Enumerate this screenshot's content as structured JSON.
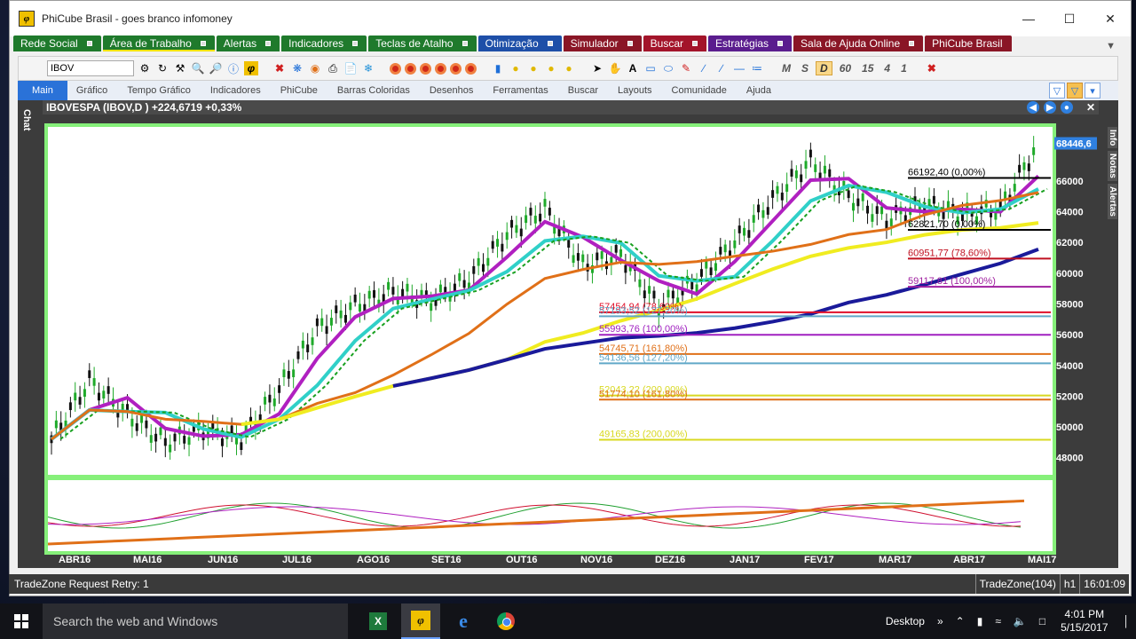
{
  "window": {
    "title": "PhiCube Brasil - goes branco infomoney",
    "logo": "phi-logo"
  },
  "top_tabs": [
    {
      "label": "Rede Social",
      "color": "#1f7a2c"
    },
    {
      "label": "Área de Trabalho",
      "color": "#1f7a2c",
      "active": true
    },
    {
      "label": "Alertas",
      "color": "#1f7a2c"
    },
    {
      "label": "Indicadores",
      "color": "#1f7a2c"
    },
    {
      "label": "Teclas de Atalho",
      "color": "#1f7a2c"
    },
    {
      "label": "Otimização",
      "color": "#1e4fa8"
    },
    {
      "label": "Simulador",
      "color": "#8a1626"
    },
    {
      "label": "Buscar",
      "color": "#a3142a"
    },
    {
      "label": "Estratégias",
      "color": "#5a1d8e"
    },
    {
      "label": "Sala de Ajuda Online",
      "color": "#8a1626"
    },
    {
      "label": "PhiCube Brasil",
      "color": "#8a1626"
    }
  ],
  "toolbar": {
    "symbol_value": "IBOV",
    "periods": [
      "M",
      "S",
      "D",
      "60",
      "15",
      "4",
      "1"
    ],
    "active_period": "D"
  },
  "menu": {
    "items": [
      "Main",
      "Gráfico",
      "Tempo Gráfico",
      "Indicadores",
      "PhiCube",
      "Barras Coloridas",
      "Desenhos",
      "Ferramentas",
      "Buscar",
      "Layouts",
      "Comunidade",
      "Ajuda"
    ],
    "active": "Main"
  },
  "chart": {
    "header": "IBOVESPA (IBOV,D ) +224,6719 +0,33%",
    "left_tab": "Chat",
    "right_tabs": [
      "Info",
      "Notas",
      "Alertas"
    ],
    "last_price": "68446,6",
    "accent": "#2f80e0",
    "background": "#ffffff",
    "border": "#86f07a"
  },
  "chart_data": {
    "type": "line",
    "title": "IBOVESPA (IBOV,D ) +224,6719 +0,33%",
    "x_tick_labels": [
      "ABR16",
      "MAI16",
      "JUN16",
      "JUL16",
      "AGO16",
      "SET16",
      "OUT16",
      "NOV16",
      "DEZ16",
      "JAN17",
      "FEV17",
      "MAR17",
      "ABR17",
      "MAI17"
    ],
    "y_tick_labels": [
      "48000",
      "50000",
      "52000",
      "54000",
      "56000",
      "58000",
      "60000",
      "62000",
      "64000",
      "66000"
    ],
    "ylim": [
      47000,
      69400
    ],
    "last_value": 68446.6,
    "price_series": [
      {
        "month": "ABR16",
        "value": 49200
      },
      {
        "month": "ABR16b",
        "value": 53000
      },
      {
        "month": "MAI16",
        "value": 50800
      },
      {
        "month": "MAI16b",
        "value": 49000
      },
      {
        "month": "JUN16",
        "value": 49800
      },
      {
        "month": "JUN16b",
        "value": 49200
      },
      {
        "month": "JUL16",
        "value": 52500
      },
      {
        "month": "JUL16b",
        "value": 56400
      },
      {
        "month": "AGO16",
        "value": 57900
      },
      {
        "month": "AGO16b",
        "value": 58800
      },
      {
        "month": "SET16",
        "value": 58200
      },
      {
        "month": "SET16b",
        "value": 59600
      },
      {
        "month": "OUT16",
        "value": 62500
      },
      {
        "month": "OUT16b",
        "value": 64200
      },
      {
        "month": "NOV16",
        "value": 60500
      },
      {
        "month": "NOV16b",
        "value": 61200
      },
      {
        "month": "DEZ16",
        "value": 57800
      },
      {
        "month": "DEZ16b",
        "value": 59500
      },
      {
        "month": "JAN17",
        "value": 62000
      },
      {
        "month": "JAN17b",
        "value": 64800
      },
      {
        "month": "FEV17",
        "value": 67300
      },
      {
        "month": "FEV17b",
        "value": 65000
      },
      {
        "month": "MAR17",
        "value": 63500
      },
      {
        "month": "MAR17b",
        "value": 64500
      },
      {
        "month": "ABR17",
        "value": 63800
      },
      {
        "month": "ABR17b",
        "value": 64200
      },
      {
        "month": "MAI17",
        "value": 68446.6
      }
    ],
    "horizontal_lines": [
      {
        "label": "62821,70 (0,00%)",
        "value": 62821.7,
        "color": "#000000"
      },
      {
        "label": "60951,77 (78,60%)",
        "value": 60951.77,
        "color": "#c01020"
      },
      {
        "label": "59117,81 (100,00%)",
        "value": 59117.81,
        "color": "#a020a0"
      },
      {
        "label": "57454,94 (78,60%)",
        "value": 57454.94,
        "color": "#e0102a"
      },
      {
        "label": "57193,52 (127,20%)",
        "value": 57193.52,
        "color": "#60a8c8"
      },
      {
        "label": "55993,76 (100,00%)",
        "value": 55993.76,
        "color": "#a020c0"
      },
      {
        "label": "54745,71 (161,80%)",
        "value": 54745.71,
        "color": "#e07018"
      },
      {
        "label": "54136,56 (127,20%)",
        "value": 54136.56,
        "color": "#60a8c8"
      },
      {
        "label": "52043,22 (200,00%)",
        "value": 52043.22,
        "color": "#d8d820"
      },
      {
        "label": "51774,10 (161,80%)",
        "value": 51774.1,
        "color": "#e07018"
      },
      {
        "label": "49165,83 (200,00%)",
        "value": 49165.83,
        "color": "#d8d820"
      },
      {
        "label": "66192,40 (0,00%)",
        "value": 66192.4,
        "color": "#000000"
      }
    ]
  },
  "statusbar": {
    "left": "TradeZone Request Retry: 1",
    "tradezone": "TradeZone(104)",
    "timeframe": "h1",
    "time": "16:01:09"
  },
  "taskbar": {
    "search_placeholder": "Search the web and Windows",
    "desktop_label": "Desktop",
    "clock_time": "4:01 PM",
    "clock_date": "5/15/2017"
  }
}
